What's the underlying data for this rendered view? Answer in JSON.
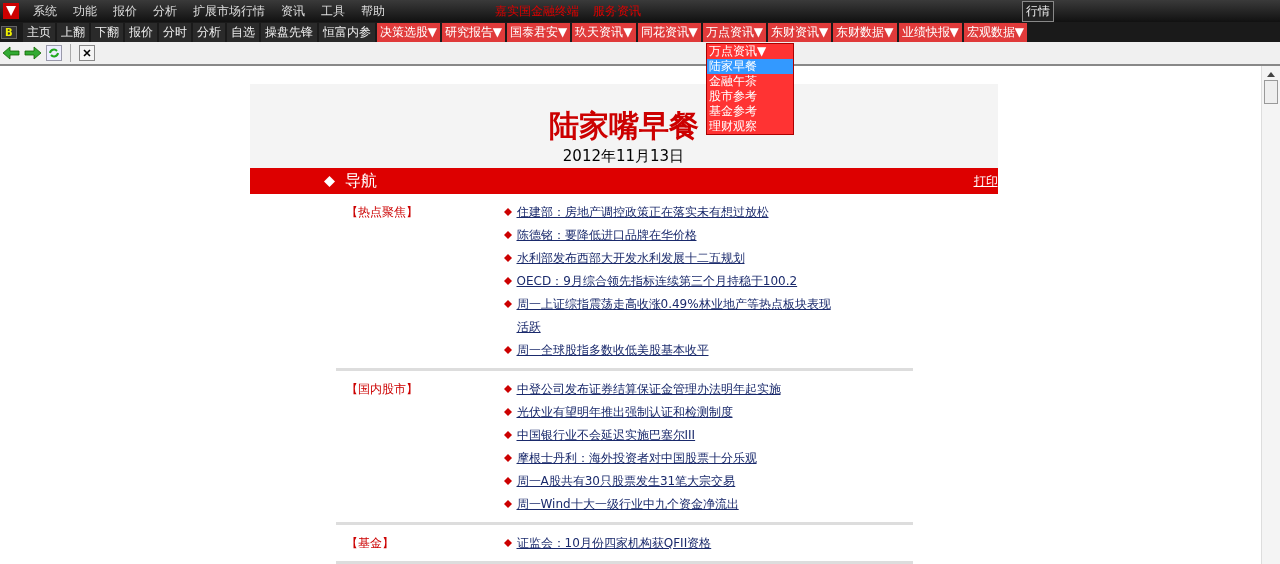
{
  "menu_bar": {
    "items": [
      "系统",
      "功能",
      "报价",
      "分析",
      "扩展市场行情",
      "资讯",
      "工具",
      "帮助"
    ],
    "notices": [
      "嘉实国金融终端",
      "服务资讯"
    ],
    "right_button": "行情"
  },
  "toolbar": {
    "badge": "B",
    "items": [
      {
        "label": "主页",
        "kind": "plain"
      },
      {
        "label": "上翻",
        "kind": "plain"
      },
      {
        "label": "下翻",
        "kind": "plain"
      },
      {
        "label": "报价",
        "kind": "plain"
      },
      {
        "label": "分时",
        "kind": "plain"
      },
      {
        "label": "分析",
        "kind": "plain"
      },
      {
        "label": "自选",
        "kind": "plain"
      },
      {
        "label": "操盘先锋",
        "kind": "plain"
      },
      {
        "label": "恒富内参",
        "kind": "plain"
      },
      {
        "label": "决策选股▼",
        "kind": "dropdown"
      },
      {
        "label": "研究报告▼",
        "kind": "dropdown"
      },
      {
        "label": "国泰君安▼",
        "kind": "dropdown"
      },
      {
        "label": "玖天资讯▼",
        "kind": "dropdown"
      },
      {
        "label": "同花资讯▼",
        "kind": "dropdown"
      },
      {
        "label": "万点资讯▼",
        "kind": "dropdown"
      },
      {
        "label": "东财资讯▼",
        "kind": "dropdown"
      },
      {
        "label": "东财数据▼",
        "kind": "dropdown"
      },
      {
        "label": "业绩快报▼",
        "kind": "dropdown"
      },
      {
        "label": "宏观数据▼",
        "kind": "dropdown"
      }
    ]
  },
  "dropdown": {
    "title": "万点资讯▼",
    "items": [
      {
        "label": "陆家早餐",
        "selected": true
      },
      {
        "label": "金融午茶",
        "selected": false
      },
      {
        "label": "股市参考",
        "selected": false
      },
      {
        "label": "基金参考",
        "selected": false
      },
      {
        "label": "理财观察",
        "selected": false
      }
    ]
  },
  "page": {
    "title": "陆家嘴早餐",
    "date": "2012年11月13日",
    "nav_title": "导航",
    "print_link": "打印",
    "sections": [
      {
        "label": "【热点聚焦】",
        "links": [
          "住建部：房地产调控政策正在落实未有想过放松",
          "陈德铭：要降低进口品牌在华价格",
          "水利部发布西部大开发水利发展十二五规划",
          "OECD：9月综合领先指标连续第三个月持稳于100.2",
          "周一上证综指震荡走高收涨0.49%林业地产等热点板块表现活跃",
          "周一全球股指多数收低美股基本收平"
        ]
      },
      {
        "label": "【国内股市】",
        "links": [
          "中登公司发布证券结算保证金管理办法明年起实施",
          "光伏业有望明年推出强制认证和检测制度",
          "中国银行业不会延迟实施巴塞尔III",
          "摩根士丹利：海外投资者对中国股票十分乐观",
          "周一A股共有30只股票发生31笔大宗交易",
          "周一Wind十大一级行业中九个资金净流出"
        ]
      },
      {
        "label": "【基金】",
        "links": [
          "证监会：10月份四家机构获QFII资格"
        ]
      }
    ]
  }
}
